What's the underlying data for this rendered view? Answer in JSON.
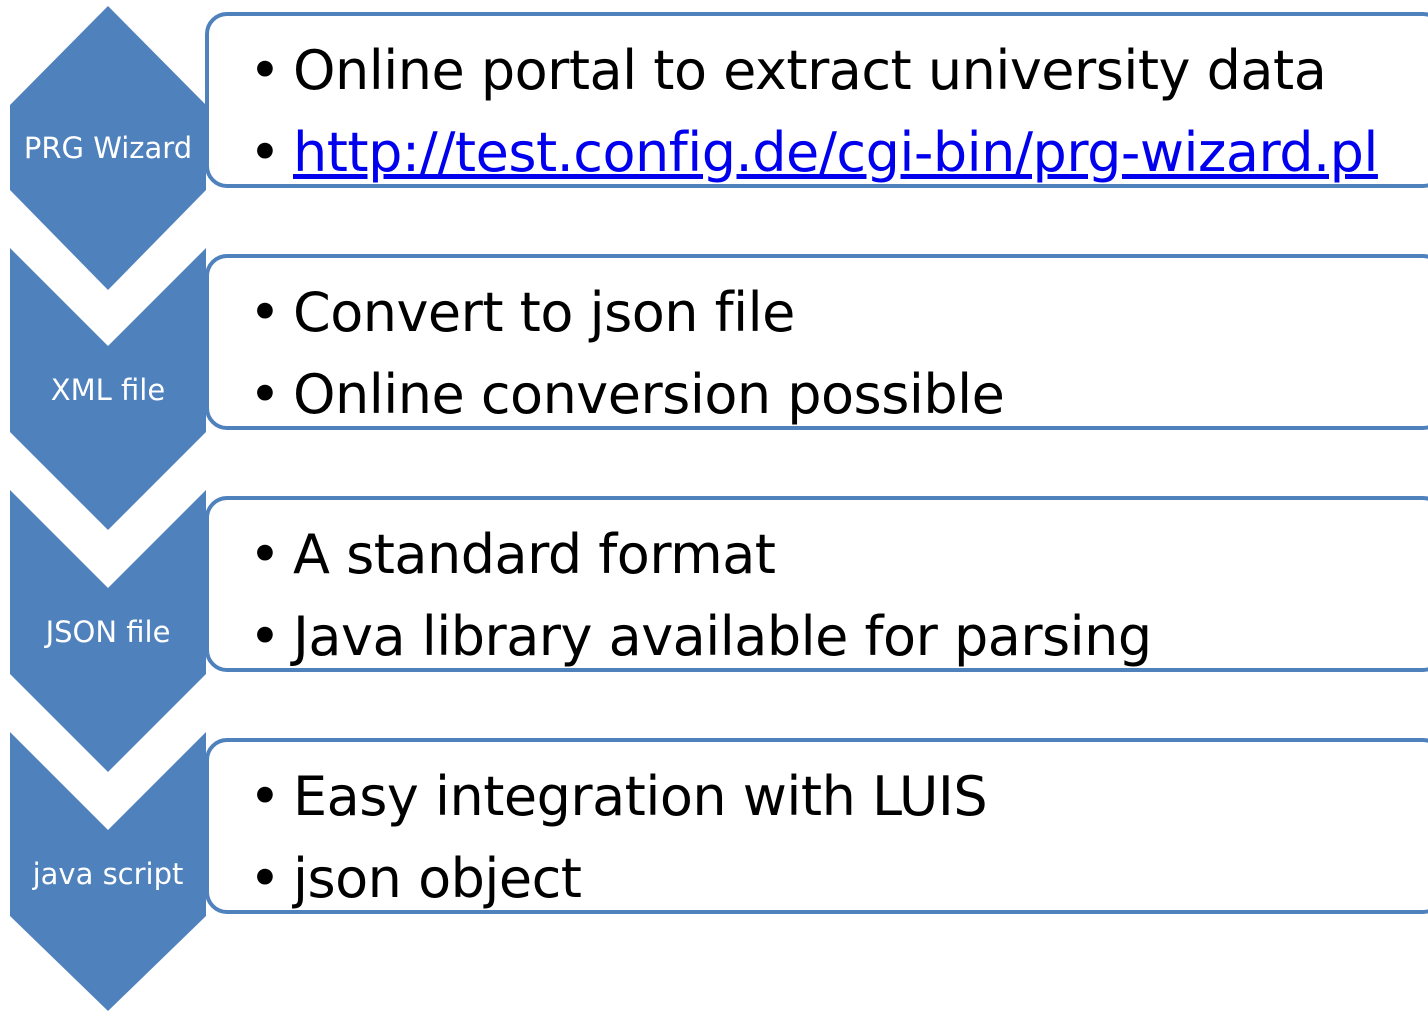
{
  "colors": {
    "chevron": "#4f81bd",
    "border": "#4f81bd",
    "text": "#000000",
    "link": "#0000ee"
  },
  "bullet_glyph": "•",
  "steps": [
    {
      "label": "PRG Wizard",
      "bullets": [
        {
          "text": "Online portal to extract university data",
          "link": false
        },
        {
          "text": "http://test.config.de/cgi-bin/prg-wizard.pl",
          "link": true
        }
      ]
    },
    {
      "label": "XML file",
      "bullets": [
        {
          "text": "Convert to json file",
          "link": false
        },
        {
          "text": "Online conversion possible",
          "link": false
        }
      ]
    },
    {
      "label": "JSON file",
      "bullets": [
        {
          "text": "A standard format",
          "link": false
        },
        {
          "text": "Java library available for parsing",
          "link": false
        }
      ]
    },
    {
      "label": "java script",
      "bullets": [
        {
          "text": "Easy integration with LUIS",
          "link": false
        },
        {
          "text": "json object",
          "link": false
        }
      ]
    }
  ]
}
